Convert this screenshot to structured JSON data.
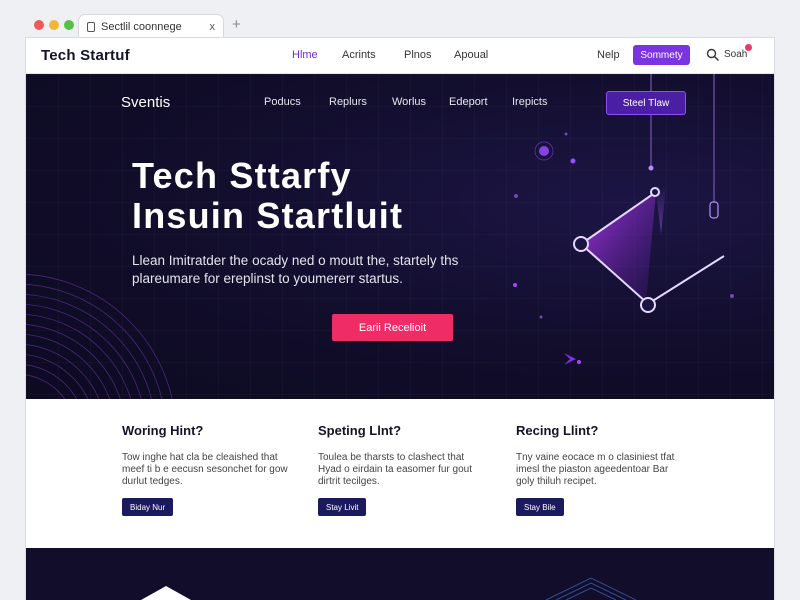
{
  "browser": {
    "tab_title": "Sectlil coonnege",
    "close_glyph": "x",
    "new_tab_glyph": "+",
    "dot_colors": [
      "#ee5a56",
      "#f3b63a",
      "#56c145"
    ]
  },
  "topnav": {
    "brand": "Tech Startuf",
    "links": [
      "Hlme",
      "Acrints",
      "Plnos",
      "Apoual"
    ],
    "active_index": 0,
    "help": "Nelp",
    "summary_button": "Sommety",
    "search_icon": "search-icon",
    "account_label": "Soah"
  },
  "hero": {
    "logo": "Sventis",
    "nav": [
      "Poducs",
      "Replurs",
      "Worlus",
      "Edeport",
      "Irepicts"
    ],
    "start_button": "Steel Tlaw",
    "title_line1": "Tech Sttarfy",
    "title_line2": "Insuin Startluit",
    "description": "Llean Imitratder the ocady ned o moutt the, startely ths plareumare for ereplinst to youmererr startus.",
    "cta": "Earii Recelioit"
  },
  "features": [
    {
      "title": "Woring Hint?",
      "desc": "Tow inghe hat cla be cleaished that meef ti b e eecusn sesonchet for gow durlut tedges.",
      "button": "Biday Nur"
    },
    {
      "title": "Speting Llnt?",
      "desc": "Toulea be tharsts to clashect that Hyad o eirdain ta easomer fur gout dirtrit tecilges.",
      "button": "Stay Livit"
    },
    {
      "title": "Recing Llint?",
      "desc": "Tny vaine eocace m o clasiniest tfat imesl the piaston ageedentoar Bar goly thiluh recipet.",
      "button": "Stay Bile"
    }
  ],
  "colors": {
    "accent": "#7a35e0",
    "cta": "#f02c67",
    "hero_bg": "#110d2a",
    "feature_button": "#1c1a5e"
  }
}
